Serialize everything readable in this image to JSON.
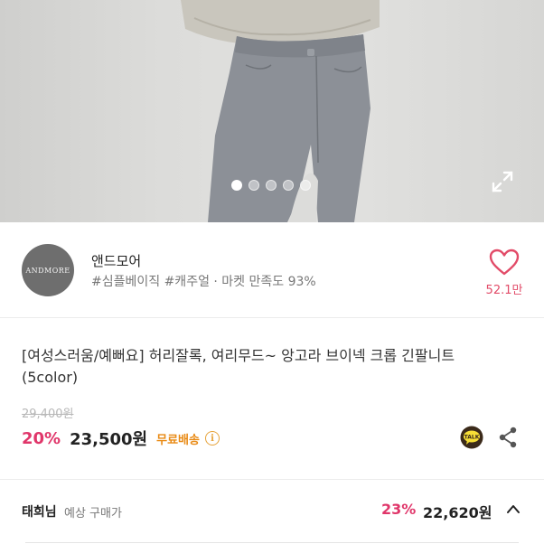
{
  "gallery": {
    "slide_count": 5,
    "active_slide": 1,
    "expand_icon": "expand-icon"
  },
  "seller": {
    "logo_text": "ANDMORE",
    "name": "앤드모어",
    "meta": "#심플베이직 #캐주얼 · 마켓 만족도 93%",
    "like_count": "52.1만",
    "like_icon": "heart-icon"
  },
  "product": {
    "title": "[여성스러움/예뻐요] 허리잘록, 여리무드~ 앙고라 브이넥 크롭 긴팔니트 (5color)",
    "original_price": "29,400원",
    "discount": "20%",
    "price": "23,500원",
    "shipping": "무료배송",
    "info_icon": "i",
    "talk_label": "TALK"
  },
  "member": {
    "name": "태희님",
    "label": "예상 구매가",
    "discount": "23%",
    "price": "22,620원"
  },
  "colors": {
    "accent": "#e0366a",
    "heart": "#e24b68",
    "shipping": "#e98a14",
    "talk": "#3b2a1a"
  }
}
